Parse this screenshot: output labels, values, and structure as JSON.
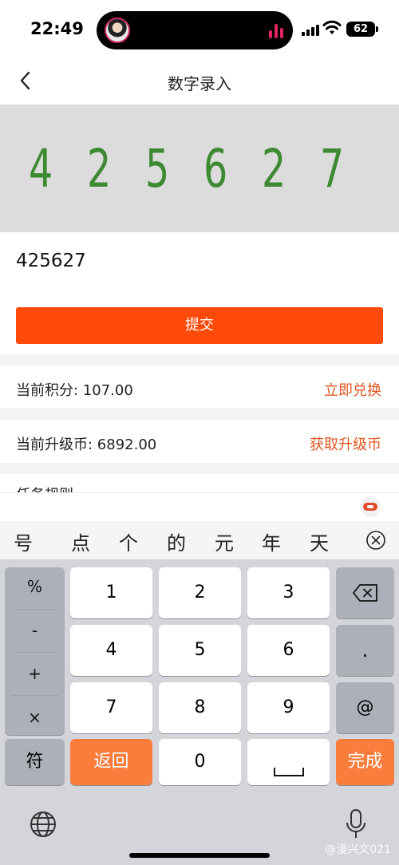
{
  "status_bar": {
    "time": "22:49",
    "battery": "62"
  },
  "nav": {
    "title": "数字录入"
  },
  "captcha": {
    "digits": [
      "4",
      "2",
      "5",
      "6",
      "2",
      "7"
    ],
    "color": "#3d8a33"
  },
  "input": {
    "value": "425627"
  },
  "submit_label": "提交",
  "points": {
    "label": "当前积分: 107.00",
    "action": "立即兑换"
  },
  "coins": {
    "label": "当前升级币: 6892.00",
    "action": "获取升级币"
  },
  "rules": {
    "label": "任务规则"
  },
  "candidates": [
    "号",
    "点",
    "个",
    "的",
    "元",
    "年",
    "天"
  ],
  "keyboard": {
    "symbols": [
      "%",
      "-",
      "+",
      "×"
    ],
    "digits": [
      "1",
      "2",
      "3",
      "4",
      "5",
      "6",
      "7",
      "8",
      "9",
      "0"
    ],
    "dot": ".",
    "at": "@",
    "fu": "符",
    "back": "返回",
    "done": "完成",
    "accent": "#fb7d3c"
  },
  "watermark": "@漫兴文021",
  "brand_color": "#ff4a0a"
}
